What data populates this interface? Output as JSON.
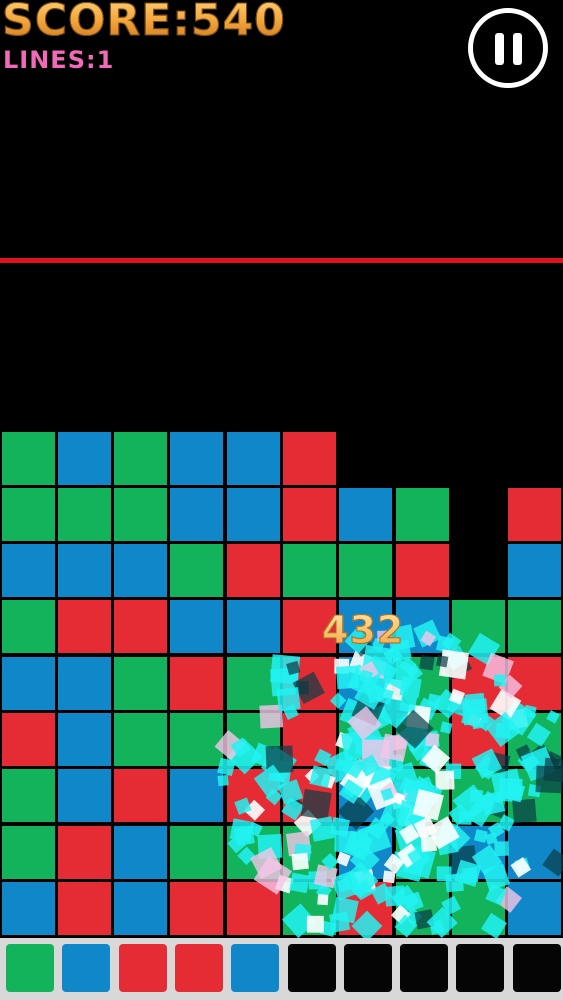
{
  "hud": {
    "score_text": "SCORE:540",
    "lines_text": "LINES:1"
  },
  "combo_text": "432",
  "colors": {
    "green": "#13b35c",
    "blue": "#0f87c8",
    "red": "#e52c35",
    "danger_line": "#e0131a",
    "burst": "#22f2f2"
  },
  "board": {
    "columns": 10,
    "rows": [
      [
        "G",
        "B",
        "G",
        "B",
        "B",
        "R",
        null,
        null,
        null,
        null
      ],
      [
        "G",
        "G",
        "G",
        "B",
        "B",
        "R",
        "B",
        "G",
        null,
        "R"
      ],
      [
        "B",
        "B",
        "B",
        "G",
        "R",
        "G",
        "G",
        "R",
        null,
        "B"
      ],
      [
        "G",
        "R",
        "R",
        "B",
        "B",
        "R",
        "B",
        "B",
        "G",
        "G"
      ],
      [
        "B",
        "B",
        "G",
        "R",
        "G",
        "R",
        "B",
        "G",
        "R",
        "R"
      ],
      [
        "R",
        "B",
        "G",
        "G",
        "G",
        "R",
        "G",
        "G",
        "R",
        "G"
      ],
      [
        "G",
        "B",
        "R",
        "B",
        "R",
        "R",
        "B",
        "G",
        "G",
        "G"
      ],
      [
        "G",
        "R",
        "B",
        "G",
        "G",
        "G",
        "B",
        "G",
        "B",
        "B"
      ],
      [
        "B",
        "R",
        "B",
        "R",
        "R",
        "G",
        "R",
        "G",
        "G",
        "B"
      ]
    ]
  },
  "queue": {
    "slots": [
      "green",
      "blue",
      "red",
      "red",
      "blue",
      "empty",
      "empty",
      "empty",
      "empty",
      "empty"
    ]
  },
  "icons": {
    "pause": "pause-icon"
  }
}
